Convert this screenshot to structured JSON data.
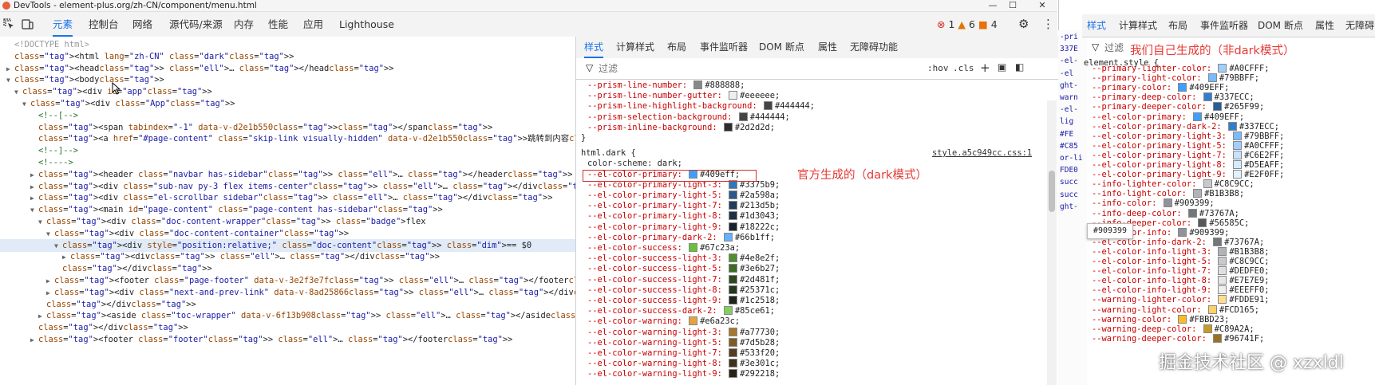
{
  "window": {
    "title": "DevTools - element-plus.org/zh-CN/component/menu.html",
    "minimize": "—",
    "maximize": "☐",
    "close": "✕"
  },
  "toolbar": {
    "inspect_icon": "inspect-element-icon",
    "device_icon": "device-toggle-icon",
    "tabs": [
      "元素",
      "控制台",
      "网络",
      "源代码/来源",
      "内存",
      "性能",
      "应用",
      "Lighthouse"
    ],
    "errors": "1",
    "warnings": "6",
    "issues": "4",
    "settings_icon": "gear-icon",
    "more_icon": "kebab-icon"
  },
  "dom": [
    {
      "indent": 0,
      "tri": "",
      "t": "<!DOCTYPE html>"
    },
    {
      "indent": 0,
      "tri": "",
      "t": "<html lang=\"zh-CN\" class=\"dark\">"
    },
    {
      "indent": 0,
      "tri": "▶",
      "t": "<head> … </head>"
    },
    {
      "indent": 0,
      "tri": "▼",
      "t": "<body>"
    },
    {
      "indent": 1,
      "tri": "▼",
      "t": "<div id=\"app\">"
    },
    {
      "indent": 2,
      "tri": "▼",
      "t": "<div class=\"App\">"
    },
    {
      "indent": 3,
      "tri": "",
      "t": "<!--[-->"
    },
    {
      "indent": 3,
      "tri": "",
      "t": "<span tabindex=\"-1\" data-v-d2e1b550></span>"
    },
    {
      "indent": 3,
      "tri": "",
      "t": "<a href=\"#page-content\" class=\"skip-link visually-hidden\" data-v-d2e1b550>跳转到内容</a>"
    },
    {
      "indent": 3,
      "tri": "",
      "t": "<!--]-->"
    },
    {
      "indent": 3,
      "tri": "",
      "t": "<!---->"
    },
    {
      "indent": 3,
      "tri": "▶",
      "t": "<header class=\"navbar has-sidebar\"> … </header>"
    },
    {
      "indent": 3,
      "tri": "▶",
      "t": "<div class=\"sub-nav py-3 flex items-center\"> … </div>"
    },
    {
      "indent": 3,
      "tri": "▶",
      "t": "<div class=\"el-scrollbar sidebar\"> … </div>"
    },
    {
      "indent": 3,
      "tri": "▼",
      "t": "<main id=\"page-content\" class=\"page-content has-sidebar\">"
    },
    {
      "indent": 4,
      "tri": "▼",
      "t": "<div class=\"doc-content-wrapper\"> flex"
    },
    {
      "indent": 5,
      "tri": "▼",
      "t": "<div class=\"doc-content-container\">"
    },
    {
      "indent": 6,
      "tri": "▼",
      "t": "<div style=\"position:relative;\" class=\"doc-content\"> == $0"
    },
    {
      "indent": 7,
      "tri": "▶",
      "t": "<div> … </div>"
    },
    {
      "indent": 6,
      "tri": "",
      "t": "</div>"
    },
    {
      "indent": 5,
      "tri": "▶",
      "t": "<footer class=\"page-footer\" data-v-3e2f3e7f> … </footer> flex"
    },
    {
      "indent": 5,
      "tri": "▶",
      "t": "<div class=\"next-and-prev-link\" data-v-8ad25866> … </div>"
    },
    {
      "indent": 4,
      "tri": "",
      "t": "</div>"
    },
    {
      "indent": 4,
      "tri": "▶",
      "t": "<aside class=\"toc-wrapper\" data-v-6f13b908> … </aside>"
    },
    {
      "indent": 3,
      "tri": "",
      "t": "</div>"
    },
    {
      "indent": 3,
      "tri": "▶",
      "t": "<footer class=\"footer\"> … </footer>"
    }
  ],
  "styles": {
    "subtabs": [
      "样式",
      "计算样式",
      "布局",
      "事件监听器",
      "DOM 断点",
      "属性",
      "无障碍功能"
    ],
    "filter_placeholder": "过滤",
    "hov": ":hov",
    "cls": ".cls",
    "top_lines": [
      {
        "p": "--prism-line-number:",
        "c": "#888888",
        "v": "#888888;"
      },
      {
        "p": "--prism-line-number-gutter:",
        "c": "#eeeeee",
        "v": "#eeeeee;"
      },
      {
        "p": "--prism-line-highlight-background:",
        "c": "#444444",
        "v": "#444444;"
      },
      {
        "p": "--prism-selection-background:",
        "c": "#444444",
        "v": "#444444;"
      },
      {
        "p": "--prism-inline-background:",
        "c": "#2d2d2d",
        "v": "#2d2d2d;"
      }
    ],
    "close_brace": "}",
    "selector": "html.dark {",
    "source": "style.a5c949cc.css:1",
    "color_scheme": {
      "p": "color-scheme:",
      "v": "dark;"
    },
    "lines": [
      {
        "p": "--el-color-primary:",
        "c": "#409eff",
        "v": "#409eff;"
      },
      {
        "p": "--el-color-primary-light-3:",
        "c": "#3375b9",
        "v": "#3375b9;"
      },
      {
        "p": "--el-color-primary-light-5:",
        "c": "#2a598a",
        "v": "#2a598a;"
      },
      {
        "p": "--el-color-primary-light-7:",
        "c": "#213d5b",
        "v": "#213d5b;"
      },
      {
        "p": "--el-color-primary-light-8:",
        "c": "#1d3043",
        "v": "#1d3043;"
      },
      {
        "p": "--el-color-primary-light-9:",
        "c": "#18222c",
        "v": "#18222c;"
      },
      {
        "p": "--el-color-primary-dark-2:",
        "c": "#66b1ff",
        "v": "#66b1ff;"
      },
      {
        "p": "--el-color-success:",
        "c": "#67c23a",
        "v": "#67c23a;"
      },
      {
        "p": "--el-color-success-light-3:",
        "c": "#4e8e2f",
        "v": "#4e8e2f;"
      },
      {
        "p": "--el-color-success-light-5:",
        "c": "#3e6b27",
        "v": "#3e6b27;"
      },
      {
        "p": "--el-color-success-light-7:",
        "c": "#2d481f",
        "v": "#2d481f;"
      },
      {
        "p": "--el-color-success-light-8:",
        "c": "#25371c",
        "v": "#25371c;"
      },
      {
        "p": "--el-color-success-light-9:",
        "c": "#1c2518",
        "v": "#1c2518;"
      },
      {
        "p": "--el-color-success-dark-2:",
        "c": "#85ce61",
        "v": "#85ce61;"
      },
      {
        "p": "--el-color-warning:",
        "c": "#e6a23c",
        "v": "#e6a23c;"
      },
      {
        "p": "--el-color-warning-light-3:",
        "c": "#a77730",
        "v": "#a77730;"
      },
      {
        "p": "--el-color-warning-light-5:",
        "c": "#7d5b28",
        "v": "#7d5b28;"
      },
      {
        "p": "--el-color-warning-light-7:",
        "c": "#533f20",
        "v": "#533f20;"
      },
      {
        "p": "--el-color-warning-light-8:",
        "c": "#3e301c",
        "v": "#3e301c;"
      },
      {
        "p": "--el-color-warning-light-9:",
        "c": "#292218",
        "v": "#292218;"
      }
    ]
  },
  "annotations": {
    "official": "官方生成的（dark模式）",
    "ours": "我们自己生成的（非dark模式）"
  },
  "right": {
    "tabs": [
      "样式",
      "计算样式",
      "布局",
      "事件监听器",
      "DOM 断点",
      "属性",
      "无障碍"
    ],
    "filter_placeholder": "过滤",
    "selector": "element.style {",
    "sliver": [
      "-pri",
      "337E",
      "-el-",
      "-el",
      "ght-",
      "warn",
      "-el-",
      "lig",
      "#FE",
      "#C85",
      "or-li",
      "FDE0",
      "succ",
      "succ",
      "ght-"
    ],
    "tooltip": "#909399",
    "lines": [
      {
        "p": "--primary-lighter-color:",
        "c": "#A0CFFF",
        "v": "#A0CFFF;"
      },
      {
        "p": "--primary-light-color:",
        "c": "#79BBFF",
        "v": "#79BBFF;"
      },
      {
        "p": "--primary-color:",
        "c": "#409EFF",
        "v": "#409EFF;"
      },
      {
        "p": "--primary-deep-color:",
        "c": "#337ECC",
        "v": "#337ECC;"
      },
      {
        "p": "--primary-deeper-color:",
        "c": "#265F99",
        "v": "#265F99;"
      },
      {
        "p": "--el-color-primary:",
        "c": "#409EFF",
        "v": "#409EFF;"
      },
      {
        "p": "--el-color-primary-dark-2:",
        "c": "#337ECC",
        "v": "#337ECC;"
      },
      {
        "p": "--el-color-primary-light-3:",
        "c": "#79BBFF",
        "v": "#79BBFF;"
      },
      {
        "p": "--el-color-primary-light-5:",
        "c": "#A0CFFF",
        "v": "#A0CFFF;"
      },
      {
        "p": "--el-color-primary-light-7:",
        "c": "#C6E2FF",
        "v": "#C6E2FF;"
      },
      {
        "p": "--el-color-primary-light-8:",
        "c": "#D5EAFF",
        "v": "#D5EAFF;"
      },
      {
        "p": "--el-color-primary-light-9:",
        "c": "#E2F0FF",
        "v": "#E2F0FF;"
      },
      {
        "p": "--info-lighter-color:",
        "c": "#C8C9CC",
        "v": "#C8C9CC;"
      },
      {
        "p": "--info-light-color:",
        "c": "#B1B3B8",
        "v": "#B1B3B8;"
      },
      {
        "p": "--info-color:",
        "c": "#909399",
        "v": "#909399;"
      },
      {
        "p": "--info-deep-color:",
        "c": "#73767A",
        "v": "#73767A;"
      },
      {
        "p": "--info-deeper-color:",
        "c": "#56585C",
        "v": "#56585C;"
      },
      {
        "p": "--el-color-info:",
        "c": "#909399",
        "v": "#909399;"
      },
      {
        "p": "--el-color-info-dark-2:",
        "c": "#73767A",
        "v": "#73767A;"
      },
      {
        "p": "--el-color-info-light-3:",
        "c": "#B1B3B8",
        "v": "#B1B3B8;"
      },
      {
        "p": "--el-color-info-light-5:",
        "c": "#C8C9CC",
        "v": "#C8C9CC;"
      },
      {
        "p": "--el-color-info-light-7:",
        "c": "#DEDFE0",
        "v": "#DEDFE0;"
      },
      {
        "p": "--el-color-info-light-8:",
        "c": "#E7E7E9",
        "v": "#E7E7E9;"
      },
      {
        "p": "--el-color-info-light-9:",
        "c": "#EEEFF0",
        "v": "#EEEFF0;"
      },
      {
        "p": "--warning-lighter-color:",
        "c": "#FDDE91",
        "v": "#FDDE91;"
      },
      {
        "p": "--warning-light-color:",
        "c": "#FCD165",
        "v": "#FCD165;"
      },
      {
        "p": "--warning-color:",
        "c": "#FBBD23",
        "v": "#FBBD23;"
      },
      {
        "p": "--warning-deep-color:",
        "c": "#C89A2A",
        "v": "#C89A2A;"
      },
      {
        "p": "--warning-deeper-color:",
        "c": "#96741F",
        "v": "#96741F;"
      }
    ]
  },
  "watermark": "掘金技术社区 @ xzxldl"
}
